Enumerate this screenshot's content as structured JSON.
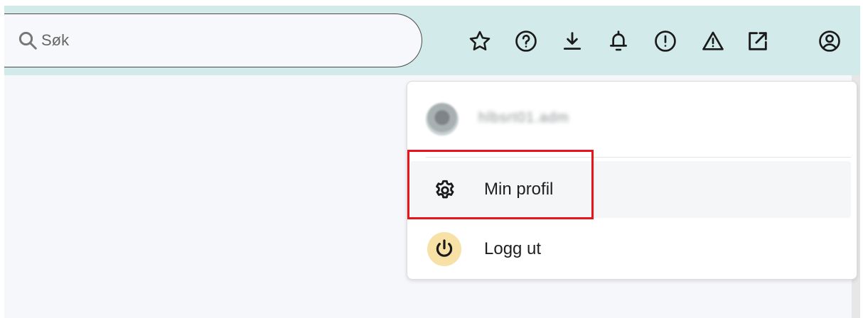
{
  "search": {
    "placeholder": "Søk",
    "value": ""
  },
  "toolbar": {
    "icons": [
      "star-icon",
      "help-icon",
      "download-icon",
      "bell-icon",
      "info-alert-icon",
      "warning-icon",
      "external-link-icon",
      "user-account-icon"
    ]
  },
  "user_menu": {
    "username": "hlbsrt01.adm",
    "items": [
      {
        "label": "Min profil",
        "icon": "gear-icon"
      },
      {
        "label": "Logg ut",
        "icon": "power-icon"
      }
    ]
  },
  "colors": {
    "topbar": "#d3eaea",
    "page_background": "#f6f7fb",
    "highlight": "#e8141a",
    "logout_icon_bg": "#f7e1a6"
  }
}
